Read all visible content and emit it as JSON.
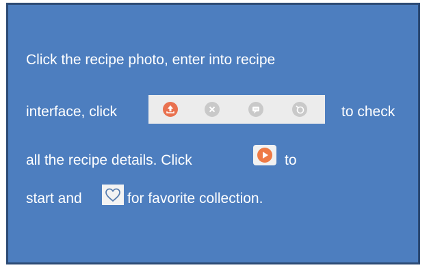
{
  "instruction": {
    "line1": "Click the recipe photo, enter into recipe",
    "line2_a": "interface, click",
    "line2_b": "to check",
    "line3_a": "all the recipe details. Click",
    "line3_b": "to",
    "line4_a": "start  and",
    "line4_b": "for favorite collection."
  },
  "toolbar_icons": [
    "upload-icon",
    "close-icon",
    "comment-icon",
    "timer-icon"
  ],
  "icons": {
    "play": "play-icon",
    "heart": "heart-icon"
  },
  "colors": {
    "panel_bg": "#4d7ebf",
    "panel_border": "#2c4a74",
    "accent": "#e8623f",
    "muted_icon": "#c6c6c6"
  }
}
